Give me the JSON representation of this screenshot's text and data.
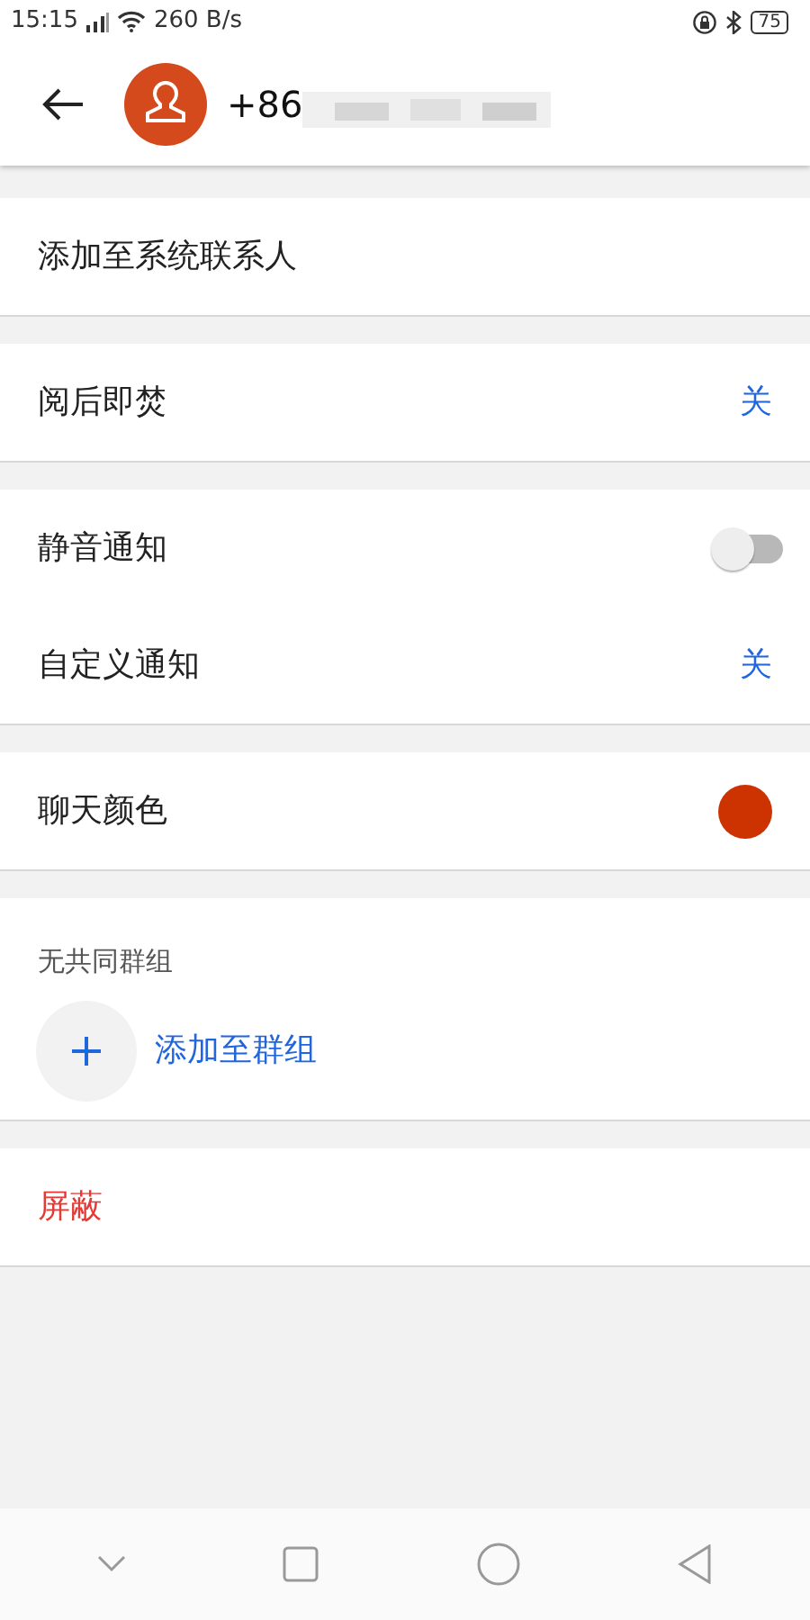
{
  "status_bar": {
    "time": "15:15",
    "net_speed": "260 B/s",
    "battery": "75"
  },
  "header": {
    "title": "+86"
  },
  "sections": [
    {
      "rows": [
        {
          "kind": "action",
          "label": "添加至系统联系人"
        }
      ]
    },
    {
      "rows": [
        {
          "kind": "value",
          "label": "阅后即焚",
          "value": "关"
        }
      ]
    },
    {
      "rows": [
        {
          "kind": "switch",
          "label": "静音通知",
          "on": false
        },
        {
          "kind": "value",
          "label": "自定义通知",
          "value": "关"
        }
      ]
    },
    {
      "rows": [
        {
          "kind": "color",
          "label": "聊天颜色",
          "color": "#cc3300"
        }
      ]
    },
    {
      "rows": [
        {
          "kind": "heading",
          "label": "无共同群组"
        },
        {
          "kind": "add",
          "label": "添加至群组"
        }
      ]
    },
    {
      "rows": [
        {
          "kind": "danger",
          "label": "屏蔽"
        }
      ]
    }
  ]
}
